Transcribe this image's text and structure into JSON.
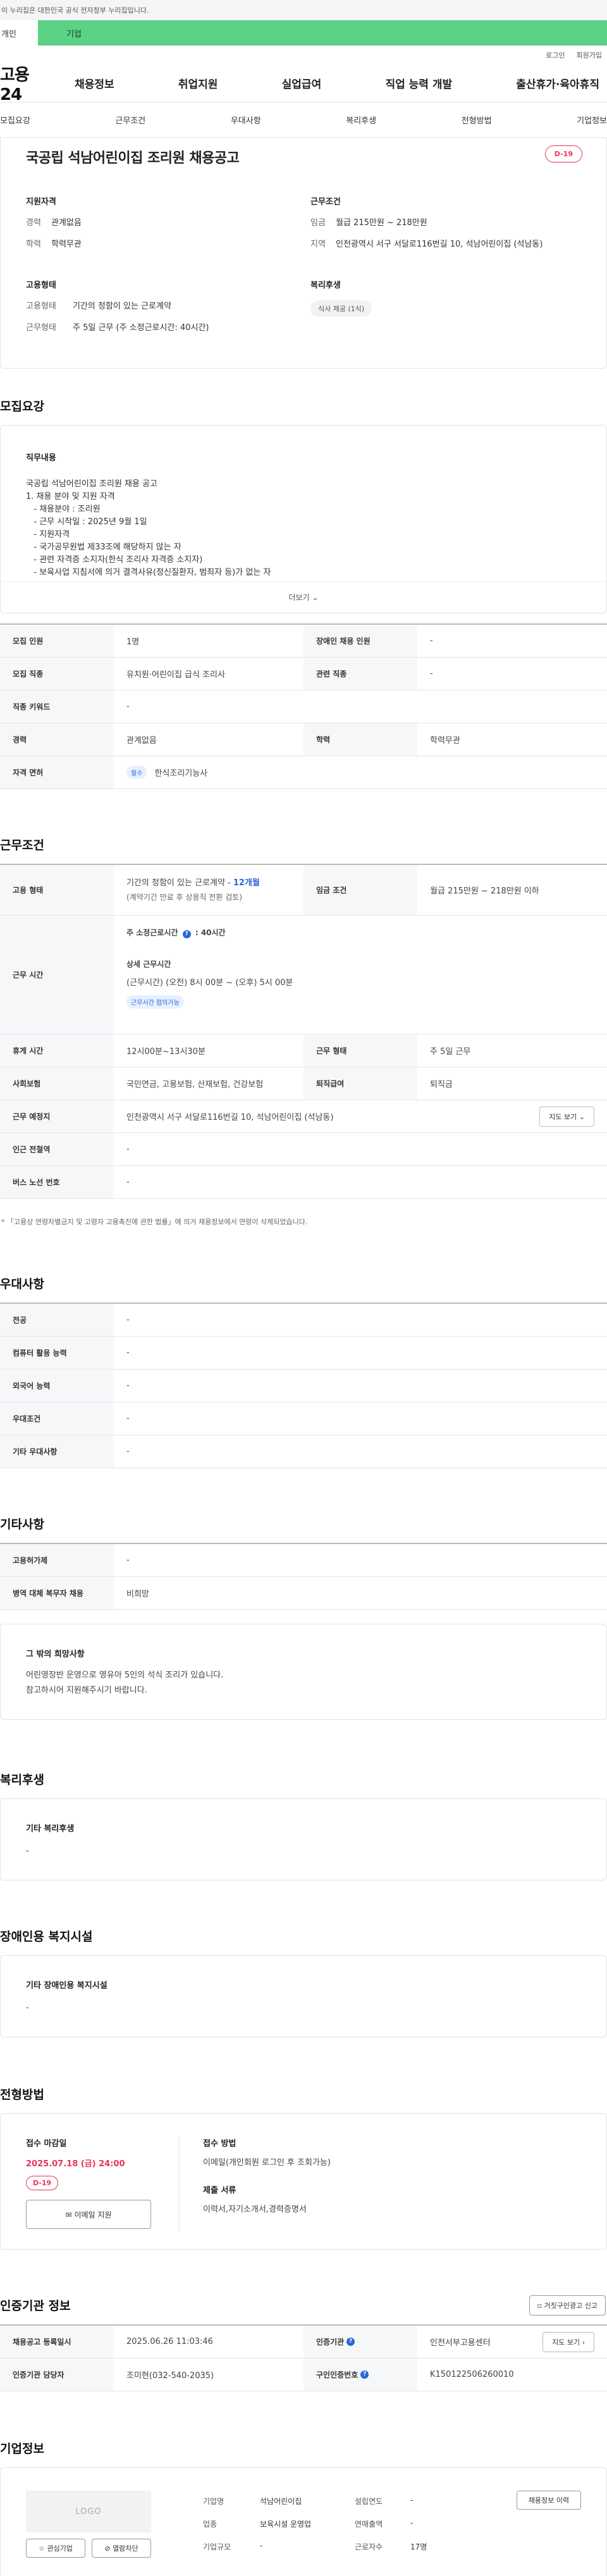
{
  "gov_notice": "이 누리집은 대한민국 공식 전자정부 누리집입니다.",
  "top_tabs": {
    "individual": "개인",
    "business": "기업"
  },
  "util": {
    "login": "로그인",
    "join": "회원가입"
  },
  "site_logo": "고용24",
  "gnb": [
    "채용정보",
    "취업지원",
    "실업급여",
    "직업 능력 개발",
    "출산휴가·육아휴직"
  ],
  "subtabs": [
    "모집요강",
    "근무조건",
    "우대사항",
    "복리후생",
    "전형방법",
    "기업정보"
  ],
  "job": {
    "title": "국공립 석남어린이집 조리원 채용공고",
    "dday": "D-19",
    "qualifications_title": "지원자격",
    "work_cond_title": "근무조건",
    "qual": [
      {
        "k": "경력",
        "v": "관계없음"
      },
      {
        "k": "학력",
        "v": "학력무관"
      }
    ],
    "cond": [
      {
        "k": "임금",
        "v": "월급 215만원 ~ 218만원"
      },
      {
        "k": "지역",
        "v": "인천광역시 서구 서달로116번길 10, 석남어린이집 (석남동)"
      }
    ],
    "emp_title": "고용형태",
    "emp": [
      {
        "k": "고용형태",
        "v": "기간의 정함이 있는 근로계약"
      },
      {
        "k": "근무형태",
        "v": "주 5일 근무 (주 소정근로시간: 40시간)"
      }
    ],
    "welfare_title": "복리후생",
    "welfare_chip": "식사 제공 (1식)"
  },
  "recruit": {
    "section": "모집요강",
    "card_title": "직무내용",
    "lines": [
      "국공립 석남어린이집 조리원 채용 공고",
      "",
      "1. 채용 분야 및 지원 자격",
      "   - 채용분야 : 조리원",
      "   - 근무 시작일 : 2025년 9월 1일",
      "   - 지원자격",
      "   - 국가공무원법 제33조에 해당하지 않는 자",
      "   - 관련 자격증 소지자(한식 조리사 자격증 소지자)",
      "   - 보육사업 지침서에 의거 결격사유(정신질환자, 범죄자 등)가 없는 자"
    ],
    "more": "더보기",
    "table": [
      {
        "k1": "모집 인원",
        "v1": "1명",
        "k2": "장애인 채용 인원",
        "v2": "-"
      },
      {
        "k1": "모집 직종",
        "v1": "유치원·어린이집 급식 조리사",
        "k2": "관련 직종",
        "v2": "-"
      },
      {
        "k1": "직종 키워드",
        "v1": "-"
      },
      {
        "k1": "경력",
        "v1": "관계없음",
        "k2": "학력",
        "v2": "학력무관"
      }
    ],
    "license_k": "자격 면허",
    "license_badge": "필수",
    "license_v": "한식조리기능사"
  },
  "work": {
    "section": "근무조건",
    "emp_k": "고용 형태",
    "emp_v1": "기간의 정함이 있는 근로계약 - ",
    "emp_v1_blue": "12개월",
    "emp_v2": "(계약기간 만료 후 상용직 전환 검토)",
    "wage_k": "임금 조건",
    "wage_v": "월급 215만원 ~ 218만원 이하",
    "hours_k": "근무 시간",
    "hours_title": "주 소정근로시간",
    "hours_value": ": 40시간",
    "hours_detail_title": "상세 근무시간",
    "hours_detail": "(근무시간) (오전) 8시 00분 ~ (오후) 5시 00분",
    "hours_badge": "근무시간 협의가능",
    "break_k": "휴게 시간",
    "break_v": "12시00분~13시30분",
    "shape_k": "근무 형태",
    "shape_v": "주 5일 근무",
    "ins_k": "사회보험",
    "ins_v": "국민연금, 고용보험, 산재보험, 건강보험",
    "retire_k": "퇴직급여",
    "retire_v": "퇴직금",
    "place_k": "근무 예정지",
    "place_v": "인천광역시 서구 서달로116번길 10, 석남어린이집 (석남동)",
    "map_btn": "지도 보기",
    "subway_k": "인근 전철역",
    "subway_v": "-",
    "bus_k": "버스 노선 번호",
    "bus_v": "-",
    "note": "* 「고용상 연령차별금지 및 고령자 고용촉진에 관한 법률」에 의거 채용정보에서 연령이 삭제되었습니다."
  },
  "pref": {
    "section": "우대사항",
    "rows": [
      {
        "k": "전공",
        "v": "-"
      },
      {
        "k": "컴퓨터 활용 능력",
        "v": "-"
      },
      {
        "k": "외국어 능력",
        "v": "-"
      },
      {
        "k": "우대조건",
        "v": "-"
      },
      {
        "k": "기타 우대사항",
        "v": "-"
      }
    ]
  },
  "etc": {
    "section": "기타사항",
    "rows": [
      {
        "k": "고용허가제",
        "v": "-"
      },
      {
        "k": "병역 대체 복무자 채용",
        "v": "비희망"
      }
    ],
    "card_title": "그 밖의 희망사항",
    "card_lines": [
      "어린영장반 운영으로 영유아 5인의 석식 조리가 있습니다.",
      "참고하시어 지원해주시기 바랍니다."
    ]
  },
  "welfare": {
    "section": "복리후생",
    "card_title": "기타 복리후생",
    "value": "-"
  },
  "disabled": {
    "section": "장애인용 복지시설",
    "card_title": "기타 장애인용 복지시설",
    "value": "-"
  },
  "process": {
    "section": "전형방법",
    "deadline_title": "접수 마감일",
    "deadline": "2025.07.18 (금) 24:00",
    "dday": "D-19",
    "email_btn": "이메일 지원",
    "method_title": "접수 방법",
    "method": "이메일(개인회원 로그인 후 조회가능)",
    "docs_title": "제출 서류",
    "docs": "이력서,자기소개서,경력증명서"
  },
  "auth": {
    "section": "인증기관 정보",
    "report_btn": "거짓구인광고 신고",
    "rows": [
      {
        "k1": "채용공고 등록일시",
        "v1": "2025.06.26 11:03:46",
        "k2": "인증기관",
        "v2": "인천서부고용센터",
        "btn": "지도 보기"
      },
      {
        "k1": "인증기관 담당자",
        "v1": "조미현(032-540-2035)",
        "k2": "구인인증번호",
        "v2": "K150122506260010"
      }
    ]
  },
  "company": {
    "section": "기업정보",
    "logo": "LOGO",
    "fav_btn": "관심기업",
    "block_btn": "열람차단",
    "info_btn": "채용정보 이력",
    "fields": [
      {
        "k": "기업명",
        "v": "석남어린이집"
      },
      {
        "k": "업종",
        "v": "보육시설 운영업"
      },
      {
        "k": "기업규모",
        "v": "-"
      }
    ],
    "fields2": [
      {
        "k": "설립연도",
        "v": "-"
      },
      {
        "k": "연매출액",
        "v": "-"
      },
      {
        "k": "근로자수",
        "v": "17명"
      }
    ]
  }
}
